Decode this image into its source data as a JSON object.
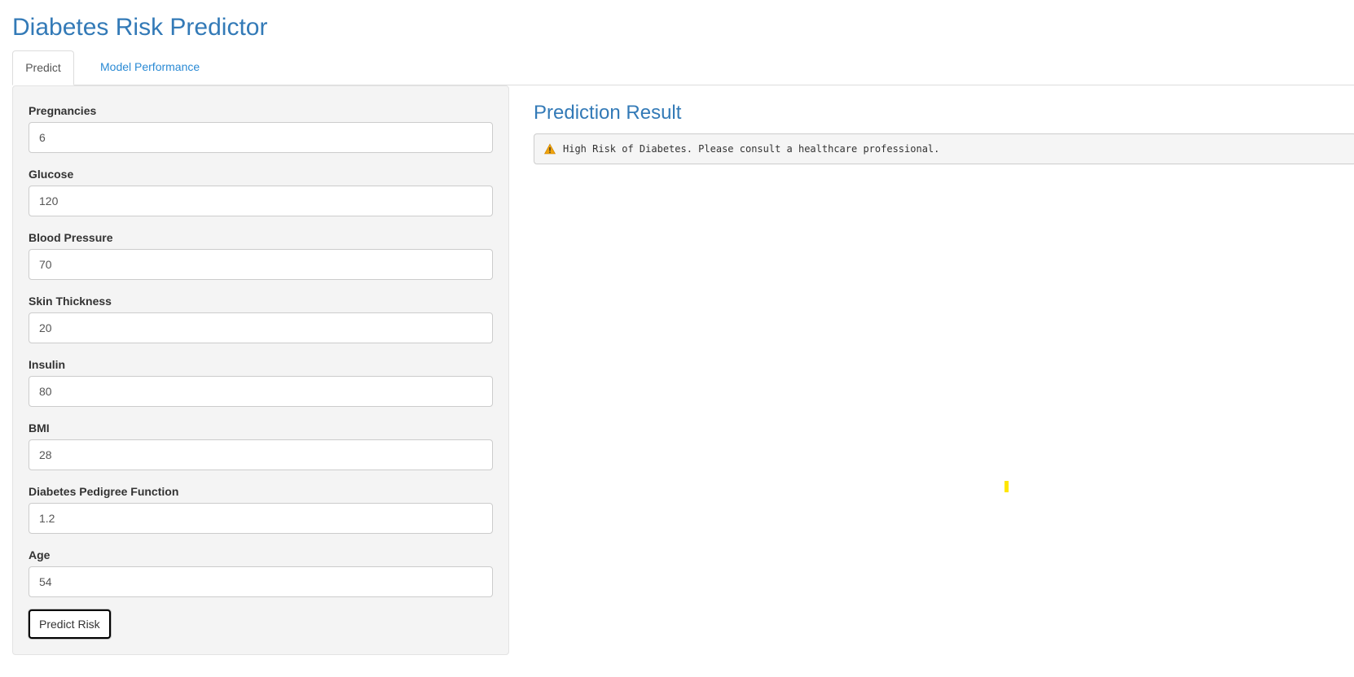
{
  "app": {
    "title": "Diabetes Risk Predictor"
  },
  "tabs": [
    {
      "label": "Predict",
      "active": true
    },
    {
      "label": "Model Performance",
      "active": false
    }
  ],
  "form": {
    "fields": [
      {
        "label": "Pregnancies",
        "value": "6"
      },
      {
        "label": "Glucose",
        "value": "120"
      },
      {
        "label": "Blood Pressure",
        "value": "70"
      },
      {
        "label": "Skin Thickness",
        "value": "20"
      },
      {
        "label": "Insulin",
        "value": "80"
      },
      {
        "label": "BMI",
        "value": "28"
      },
      {
        "label": "Diabetes Pedigree Function",
        "value": "1.2"
      },
      {
        "label": "Age",
        "value": "54"
      }
    ],
    "submit_label": "Predict Risk"
  },
  "result": {
    "title": "Prediction Result",
    "icon": "warning-icon",
    "message": "High Risk of Diabetes. Please consult a healthcare professional."
  },
  "colors": {
    "accent": "#337ab7",
    "link": "#2a8ad4",
    "warning": "#f0a30a",
    "marker": "#ffe600"
  }
}
